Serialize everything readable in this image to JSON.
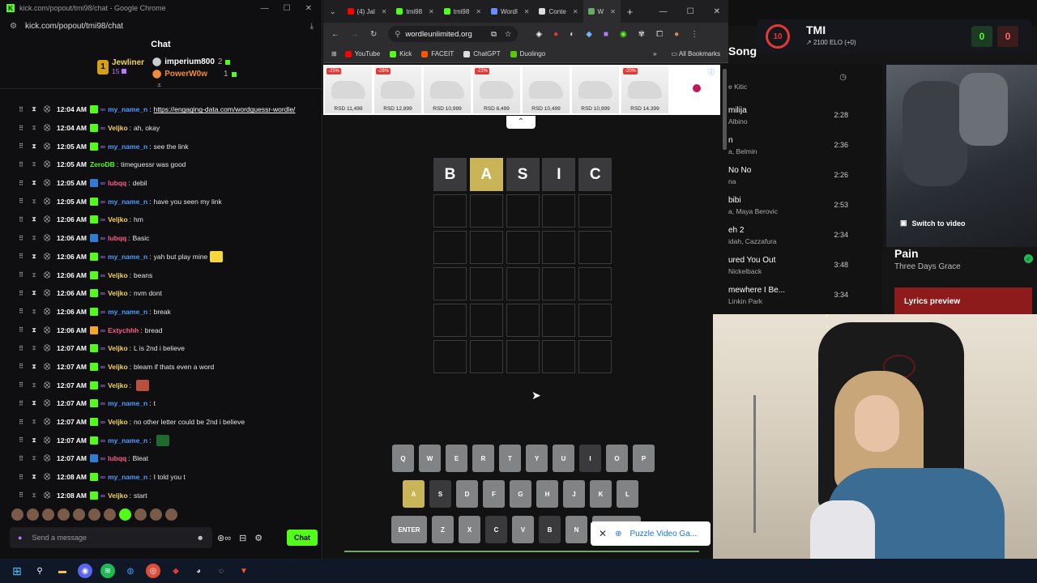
{
  "chat_window": {
    "title": "kick.com/popout/tmi98/chat - Google Chrome",
    "url": "kick.com/popout/tmi98/chat",
    "header": "Chat",
    "podium": {
      "first": {
        "rank": "1",
        "name": "Jewliner",
        "count": "15"
      },
      "second": {
        "name": "imperium800",
        "count": "2"
      },
      "third": {
        "name": "PowerW0w",
        "count": "1"
      }
    },
    "messages": [
      {
        "time": "12:04 AM",
        "user": "my_name_n",
        "color": "#4f9cff",
        "text": "https://engaging-data.com/wordguessr-wordle/",
        "link": true,
        "badge": "#53fc18"
      },
      {
        "time": "12:04 AM",
        "user": "Veljko",
        "color": "#f4d35e",
        "text": "ah, okay",
        "badge": "#53fc18"
      },
      {
        "time": "12:05 AM",
        "user": "my_name_n",
        "color": "#4f9cff",
        "text": "see the link",
        "badge": "#53fc18"
      },
      {
        "time": "12:05 AM",
        "user": "ZeroDB",
        "color": "#53fc18",
        "text": "timeguessr was good",
        "badge": ""
      },
      {
        "time": "12:05 AM",
        "user": "lubqq",
        "color": "#ff5c8a",
        "text": "debil",
        "badge": "#2f7bd6"
      },
      {
        "time": "12:05 AM",
        "user": "my_name_n",
        "color": "#4f9cff",
        "text": "have you seen my link",
        "badge": "#53fc18"
      },
      {
        "time": "12:06 AM",
        "user": "Veljko",
        "color": "#f4d35e",
        "text": "hm",
        "badge": "#53fc18"
      },
      {
        "time": "12:06 AM",
        "user": "lubqq",
        "color": "#ff5c8a",
        "text": "Basic",
        "badge": "#2f7bd6"
      },
      {
        "time": "12:06 AM",
        "user": "my_name_n",
        "color": "#4f9cff",
        "text": "yah but play mine",
        "badge": "#53fc18",
        "emote": "#f5d83a"
      },
      {
        "time": "12:06 AM",
        "user": "Veljko",
        "color": "#f4d35e",
        "text": "beans",
        "badge": "#53fc18"
      },
      {
        "time": "12:06 AM",
        "user": "Veljko",
        "color": "#f4d35e",
        "text": "nvm dont",
        "badge": "#53fc18"
      },
      {
        "time": "12:06 AM",
        "user": "my_name_n",
        "color": "#4f9cff",
        "text": "break",
        "badge": "#53fc18"
      },
      {
        "time": "12:06 AM",
        "user": "Extychhh",
        "color": "#ff5c8a",
        "text": "bread",
        "badge": "#f5a623"
      },
      {
        "time": "12:07 AM",
        "user": "Veljko",
        "color": "#f4d35e",
        "text": "L is 2nd i believe",
        "badge": "#53fc18"
      },
      {
        "time": "12:07 AM",
        "user": "Veljko",
        "color": "#f4d35e",
        "text": "bleam if thats even a word",
        "badge": "#53fc18"
      },
      {
        "time": "12:07 AM",
        "user": "Veljko",
        "color": "#f4d35e",
        "text": "",
        "badge": "#53fc18",
        "emote": "#b8503c"
      },
      {
        "time": "12:07 AM",
        "user": "my_name_n",
        "color": "#4f9cff",
        "text": "t",
        "badge": "#53fc18"
      },
      {
        "time": "12:07 AM",
        "user": "Veljko",
        "color": "#f4d35e",
        "text": "no other letter could be 2nd i believe",
        "badge": "#53fc18"
      },
      {
        "time": "12:07 AM",
        "user": "my_name_n",
        "color": "#4f9cff",
        "text": "",
        "badge": "#53fc18",
        "emote": "#1e6b2e"
      },
      {
        "time": "12:07 AM",
        "user": "lubqq",
        "color": "#ff5c8a",
        "text": "Bleat",
        "badge": "#2f7bd6"
      },
      {
        "time": "12:08 AM",
        "user": "my_name_n",
        "color": "#4f9cff",
        "text": "I told you t",
        "badge": "#53fc18"
      },
      {
        "time": "12:08 AM",
        "user": "Veljko",
        "color": "#f4d35e",
        "text": "start",
        "badge": "#53fc18"
      }
    ],
    "input_placeholder": "Send a message",
    "send_label": "Chat"
  },
  "browser": {
    "tabs": [
      {
        "label": "(4) Jal",
        "fav": "#ff0000"
      },
      {
        "label": "tmi98",
        "fav": "#53fc18"
      },
      {
        "label": "tmi98",
        "fav": "#53fc18"
      },
      {
        "label": "Wordl",
        "fav": "#6a8cff"
      },
      {
        "label": "Conte",
        "fav": "#dddddd"
      },
      {
        "label": "W",
        "fav": "#6aaa64"
      }
    ],
    "url": "wordleunlimited.org",
    "bookmarks": [
      {
        "label": "YouTube",
        "fav": "#ff0000"
      },
      {
        "label": "Kick",
        "fav": "#53fc18"
      },
      {
        "label": "FACEIT",
        "fav": "#ff5500"
      },
      {
        "label": "ChatGPT",
        "fav": "#dddddd"
      },
      {
        "label": "Duolingo",
        "fav": "#58cc02"
      }
    ],
    "all_bookmarks": "All Bookmarks",
    "ads": [
      {
        "discount": "-25%",
        "price": "RSD 11,499"
      },
      {
        "discount": "-28%",
        "price": "RSD 12,899"
      },
      {
        "discount": "",
        "price": "RSD 10,999"
      },
      {
        "discount": "-22%",
        "price": "RSD 8,499"
      },
      {
        "discount": "",
        "price": "RSD 10,499"
      },
      {
        "discount": "",
        "price": "RSD 10,999"
      },
      {
        "discount": "-20%",
        "price": "RSD 14,399"
      }
    ],
    "guess": [
      {
        "letter": "B",
        "state": "absent"
      },
      {
        "letter": "A",
        "state": "present"
      },
      {
        "letter": "S",
        "state": "absent"
      },
      {
        "letter": "I",
        "state": "absent"
      },
      {
        "letter": "C",
        "state": "absent"
      }
    ],
    "keyboard": {
      "row1": [
        "Q",
        "W",
        "E",
        "R",
        "T",
        "Y",
        "U",
        "I",
        "O",
        "P"
      ],
      "row2": [
        "A",
        "S",
        "D",
        "F",
        "G",
        "H",
        "J",
        "K",
        "L"
      ],
      "row3": [
        "ENTER",
        "Z",
        "X",
        "C",
        "V",
        "B",
        "N"
      ],
      "present": [
        "A"
      ],
      "absent": [
        "S",
        "I",
        "C",
        "B"
      ]
    },
    "toast": "Puzzle Video Ga..."
  },
  "spotify": {
    "header": "Song",
    "songs": [
      {
        "title": "",
        "artist": "e Kitic",
        "duration": ""
      },
      {
        "title": "milija",
        "artist": "Albino",
        "duration": "2:28"
      },
      {
        "title": "n",
        "artist": "a, Belmin",
        "duration": "2:36"
      },
      {
        "title": "No No",
        "artist": "na",
        "duration": "2:26"
      },
      {
        "title": "bibi",
        "artist": "a, Maya Berovic",
        "duration": "2:53"
      },
      {
        "title": "eh 2",
        "artist": "idah, Cazzafura",
        "duration": "2:34"
      },
      {
        "title": "ured You Out",
        "artist": "Nickelback",
        "duration": "3:48"
      },
      {
        "title": "mewhere I Be...",
        "artist": "Linkin Park",
        "duration": "3:34"
      }
    ],
    "switch_video": "Switch to video",
    "now_playing_title": "Pain",
    "now_playing_artist": "Three Days Grace",
    "lyrics": "Lyrics preview"
  },
  "faceit": {
    "level": "10",
    "name": "TMI",
    "elo": "2100 ELO (+0)",
    "wins": "0",
    "losses": "0"
  },
  "colors": {
    "kick_green": "#53fc18",
    "wordle_present": "#c9b458",
    "wordle_absent": "#3a3a3c",
    "wordle_key": "#818384"
  }
}
